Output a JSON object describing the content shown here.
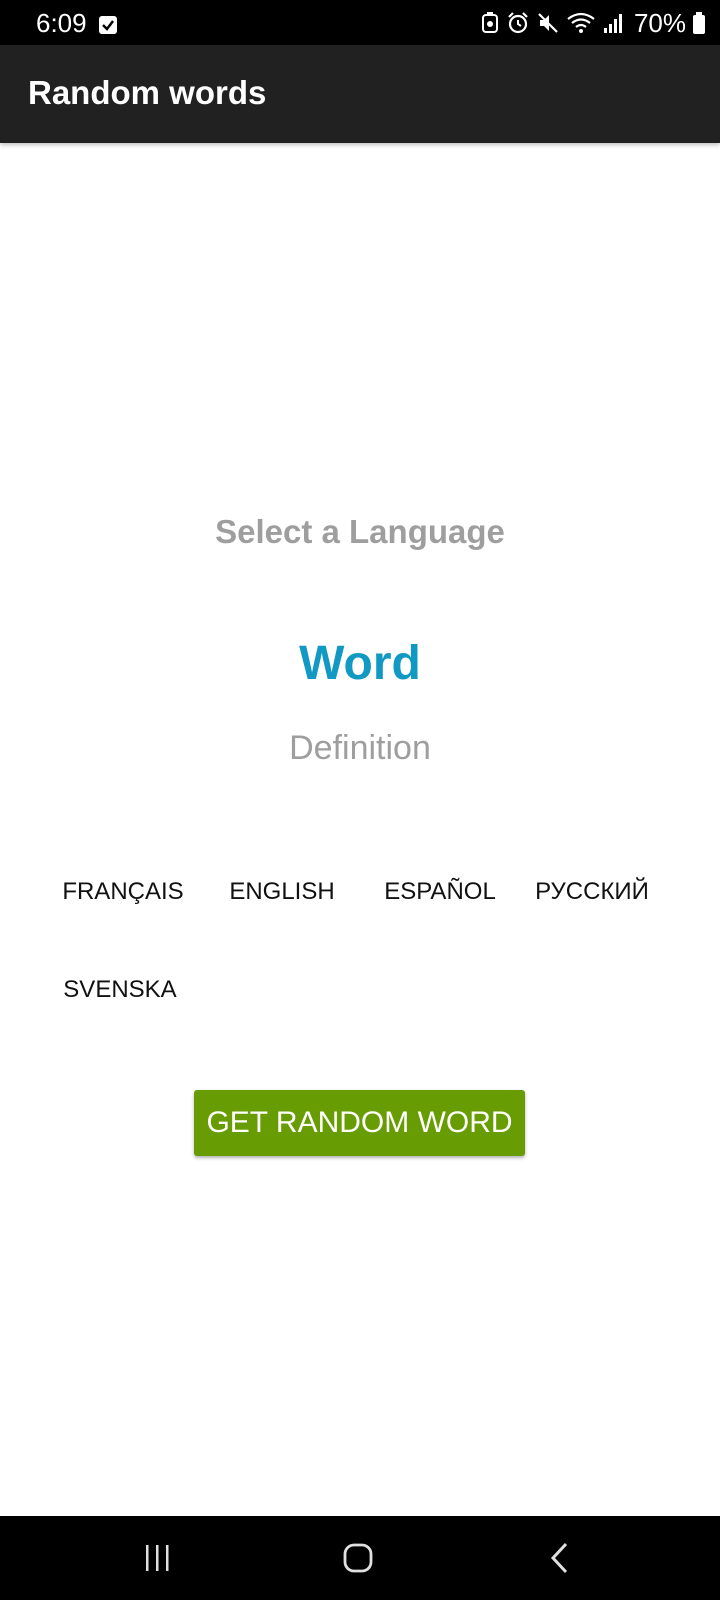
{
  "status_bar": {
    "time": "6:09",
    "battery": "70%"
  },
  "app_bar": {
    "title": "Random words"
  },
  "main": {
    "select_label": "Select a Language",
    "word": "Word",
    "definition": "Definition",
    "languages": [
      "FRANÇAIS",
      "ENGLISH",
      "ESPAÑOL",
      "РУССКИЙ",
      "SVENSKA"
    ],
    "get_random_label": "GET RANDOM WORD"
  },
  "icons": {
    "status": [
      "checkbox-icon",
      "cast-icon",
      "alarm-icon",
      "mute-icon",
      "wifi-icon",
      "signal-icon",
      "battery-icon"
    ],
    "nav": [
      "recents-icon",
      "home-icon",
      "back-icon"
    ]
  },
  "colors": {
    "accent_word": "#1199c4",
    "button": "#679d03",
    "app_bar": "#212121",
    "muted_text": "#9e9e9e"
  }
}
